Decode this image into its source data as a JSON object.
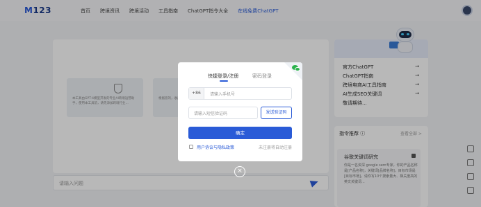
{
  "header": {
    "logo_prefix": "M",
    "logo_rest": "123",
    "nav": [
      "首页",
      "跨境资讯",
      "跨境活动",
      "工具指南",
      "ChatGPT指令大全",
      "在线免费ChatGPT"
    ]
  },
  "main": {
    "cards": [
      {
        "text": "本工具由GPT-4模型开发的专业AI跨境运营助手，使用本工具前，请先添加跨境行业..."
      },
      {
        "text": "根据您的，收藏..."
      }
    ],
    "input_placeholder": "请输入问题"
  },
  "right_panel": {
    "links": [
      {
        "label": "官方ChatGPT",
        "arrow": "→"
      },
      {
        "label": "ChatGPT指南",
        "arrow": "→"
      },
      {
        "label": "跨境电商AI工具指南",
        "arrow": "→"
      },
      {
        "label": "AI生成SEO关键词",
        "arrow": "→"
      },
      {
        "label": "敬请期待...",
        "arrow": ""
      }
    ],
    "recommend_title": "指令推荐 ⓘ",
    "recommend_more": "查看全部 >",
    "rec_item_title": "谷歌关键词研究",
    "rec_item_text": "你是一名资深 google sem专家，你的产品名称是[产品名称]，关键词[品牌名称]，目标市场是[目标市场]，请你写10个搜索量大、相关度高的英文关键词..."
  },
  "modal": {
    "tab_active": "快捷登录/注册",
    "tab_inactive": "密码登录",
    "phone_prefix": "+86",
    "phone_placeholder": "请输入手机号",
    "code_placeholder": "请输入短信验证码",
    "send_code_label": "发送验证码",
    "confirm_label": "确定",
    "agree_label": "用户协议与隐私政策",
    "auto_register_label": "未注册将自动注册",
    "close_symbol": "×"
  },
  "colors": {
    "accent": "#2a5bd7",
    "wechat": "#2bb24c"
  }
}
